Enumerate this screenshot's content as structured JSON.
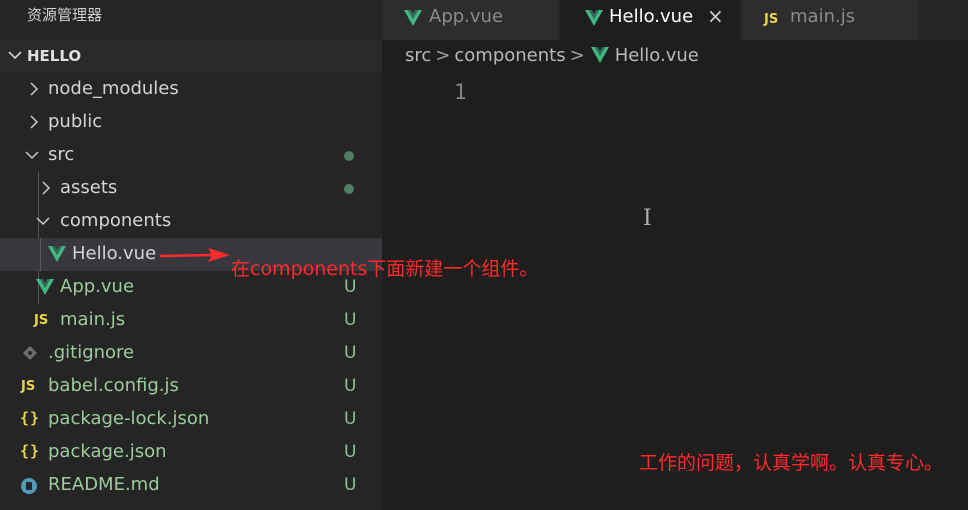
{
  "explorer": {
    "title": "资源管理器",
    "project": "HELLO",
    "items": [
      {
        "name": "node_modules",
        "status": ""
      },
      {
        "name": "public",
        "status": ""
      },
      {
        "name": "src",
        "status": ""
      },
      {
        "name": "assets",
        "status": ""
      },
      {
        "name": "components",
        "status": ""
      },
      {
        "name": "Hello.vue",
        "status": ""
      },
      {
        "name": "App.vue",
        "status": "U"
      },
      {
        "name": "main.js",
        "status": "U"
      },
      {
        "name": ".gitignore",
        "status": "U"
      },
      {
        "name": "babel.config.js",
        "status": "U"
      },
      {
        "name": "package-lock.json",
        "status": "U"
      },
      {
        "name": "package.json",
        "status": "U"
      },
      {
        "name": "README.md",
        "status": "U"
      }
    ],
    "js_badge": "JS",
    "json_badge": "{}"
  },
  "tabs": [
    {
      "label": "App.vue"
    },
    {
      "label": "Hello.vue",
      "close": "×"
    },
    {
      "label": "main.js"
    }
  ],
  "breadcrumb": {
    "parts": [
      "src",
      "components",
      "Hello.vue"
    ],
    "sep": ">"
  },
  "editor": {
    "line_number": "1",
    "cursor": "I"
  },
  "annotations": {
    "arrow_note": "在components下面新建一个组件。",
    "bottom_note": "工作的问题，认真学啊。认真专心。"
  },
  "colors": {
    "vue": "#41b883",
    "js": "#e8d34b",
    "annotation": "#ff2a2a",
    "untracked": "#73c991"
  }
}
